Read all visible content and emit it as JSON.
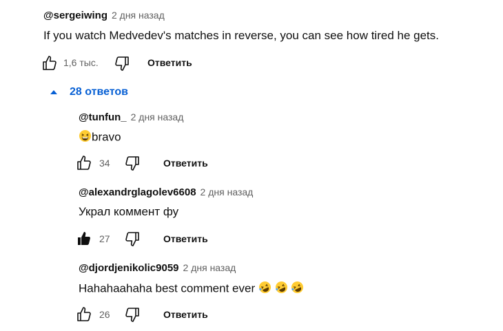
{
  "comment": {
    "author": "@sergeiwing",
    "time": "2 дня назад",
    "text": "If you watch Medvedev's matches in reverse, you can see how tired he gets.",
    "likes": "1,6 тыс.",
    "reply_label": "Ответить",
    "replies_toggle": "28 ответов"
  },
  "replies": [
    {
      "author": "@tunfun_",
      "time": "2 дня назад",
      "text": "bravo",
      "likes": "34",
      "reply_label": "Ответить",
      "liked": false,
      "emoji": "grinning-squint-face"
    },
    {
      "author": "@alexandrglagolev6608",
      "time": "2 дня назад",
      "text": "Украл коммент фу",
      "likes": "27",
      "reply_label": "Ответить",
      "liked": true
    },
    {
      "author": "@djordjenikolic9059",
      "time": "2 дня назад",
      "text": "Hahahaahaha best comment ever",
      "likes": "26",
      "reply_label": "Ответить",
      "liked": false,
      "emoji": "rolling-on-floor-laughing x3"
    }
  ]
}
